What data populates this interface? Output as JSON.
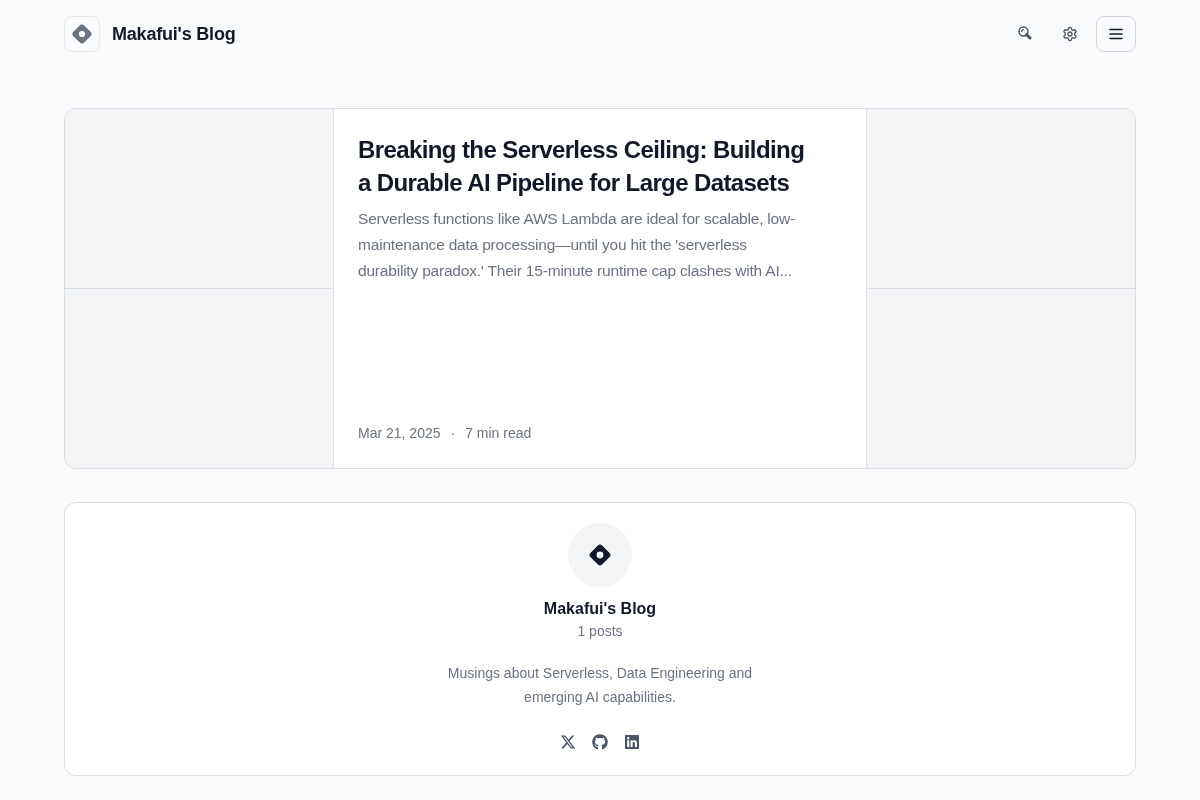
{
  "header": {
    "title": "Makafui's Blog"
  },
  "featured_post": {
    "title": "Breaking the Serverless Ceiling: Building a Durable AI Pipeline for Large Datasets",
    "excerpt": "Serverless functions like AWS Lambda are ideal for scalable, low-maintenance data processing—until you hit the 'serverless durability paradox.' Their 15-minute runtime cap clashes with AI...",
    "date": "Mar 21, 2025",
    "separator": "·",
    "read_time": "7 min read"
  },
  "profile": {
    "name": "Makafui's Blog",
    "post_count": "1 posts",
    "description": "Musings about Serverless, Data Engineering and emerging AI capabilities.",
    "social_links": [
      {
        "kind": "x"
      },
      {
        "kind": "github"
      },
      {
        "kind": "linkedin"
      }
    ]
  }
}
